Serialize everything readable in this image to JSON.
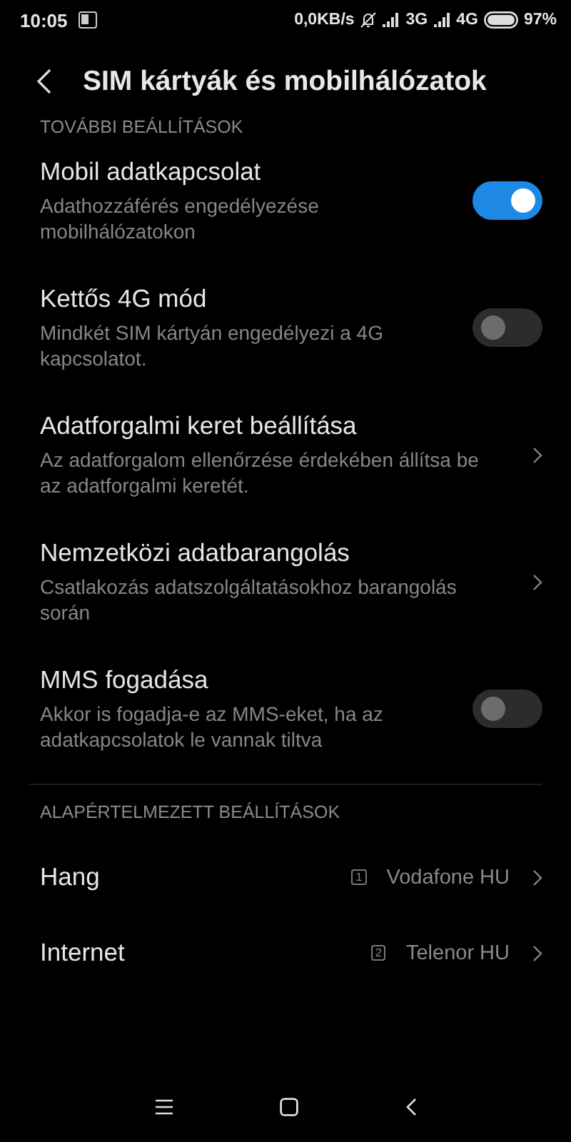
{
  "status_bar": {
    "time": "10:05",
    "speed": "0,0KB/s",
    "network_1": "3G",
    "network_2": "4G",
    "battery": "97%"
  },
  "header": {
    "title": "SIM kártyák és mobilhálózatok"
  },
  "sections": [
    {
      "title": "TOVÁBBI BEÁLLÍTÁSOK",
      "items": [
        {
          "kind": "toggle",
          "label": "Mobil adatkapcsolat",
          "description": "Adathozzáférés engedélyezése mobilhálózatokon",
          "on": true
        },
        {
          "kind": "toggle",
          "label": "Kettős 4G mód",
          "description": "Mindkét SIM kártyán engedélyezi a 4G kapcsolatot.",
          "on": false
        },
        {
          "kind": "link",
          "label": "Adatforgalmi keret beállítása",
          "description": "Az adatforgalom ellenőrzése érdekében állítsa be az adatforgalmi keretét."
        },
        {
          "kind": "link",
          "label": "Nemzetközi adatbarangolás",
          "description": "Csatlakozás adatszolgáltatásokhoz barangolás során"
        },
        {
          "kind": "toggle",
          "label": "MMS fogadása",
          "description": "Akkor is fogadja-e az MMS-eket, ha az adatkapcsolatok le vannak tiltva",
          "on": false
        }
      ]
    },
    {
      "title": "ALAPÉRTELMEZETT BEÁLLÍTÁSOK",
      "items": [
        {
          "kind": "sim",
          "label": "Hang",
          "sim": "1",
          "value": "Vodafone HU"
        },
        {
          "kind": "sim",
          "label": "Internet",
          "sim": "2",
          "value": "Telenor HU"
        }
      ]
    }
  ]
}
